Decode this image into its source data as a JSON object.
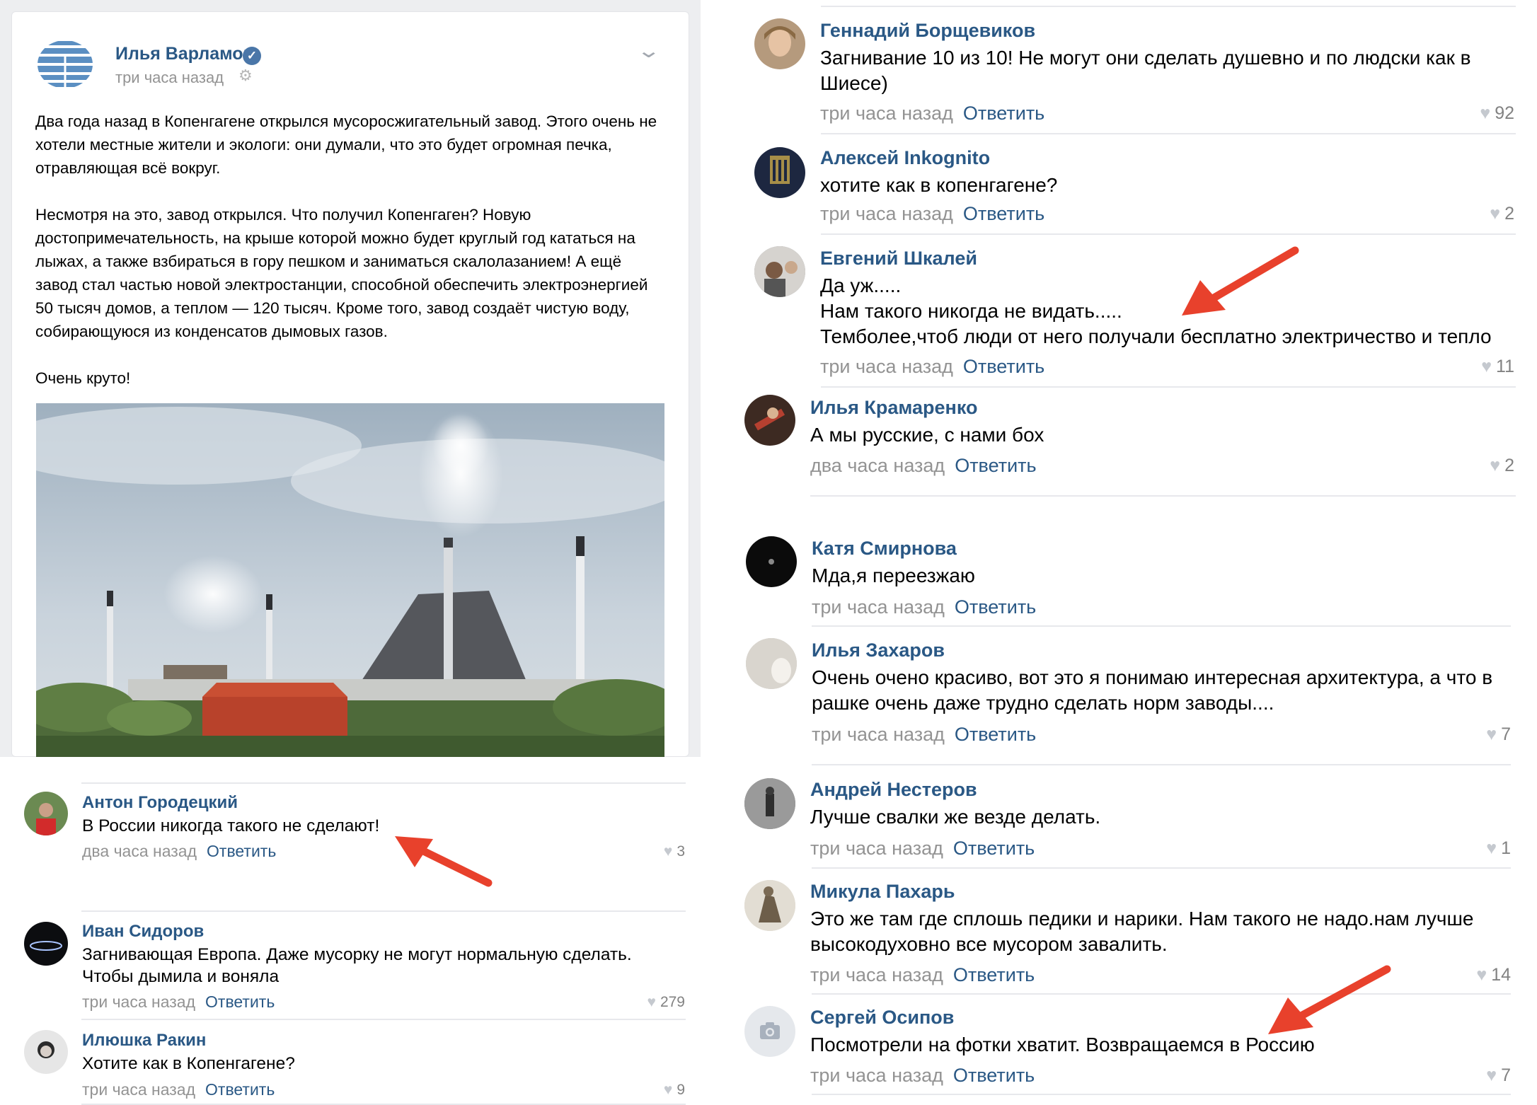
{
  "post": {
    "author": "Илья Варламов",
    "time": "три часа назад",
    "paragraphs": [
      "Два года назад в Копенгагене открылся мусоросжигательный завод. Этого очень не хотели местные жители и экологи: они думали, что это будет огромная печка, отравляющая всё вокруг.",
      "Несмотря на это, завод открылся. Что получил Копенгаген? Новую достопримечательность, на крыше которой можно будет круглый год кататься на лыжах, а также взбираться в гору пешком и заниматься скалолазанием! А ещё завод стал частью новой электростанции, способной обеспечить электроэнергией 50 тысяч домов, а теплом — 120 тысяч. Кроме того, завод создаёт чистую воду, собирающуюся из конденсатов дымовых газов.",
      "Очень круто!"
    ]
  },
  "reply_label": "Ответить",
  "left_comments": [
    {
      "name": "Антон Городецкий",
      "text": "В России никогда такого не сделают!",
      "time": "два часа назад",
      "likes": "3"
    },
    {
      "name": "Иван Сидоров",
      "text": "Загнивающая Европа. Даже мусорку не могут нормальную сделать. Чтобы дымила и воняла",
      "time": "три часа назад",
      "likes": "279"
    },
    {
      "name": "Илюшка Ракин",
      "text": "Хотите как в Копенгагене?",
      "time": "три часа назад",
      "likes": "9"
    }
  ],
  "right_comments": [
    {
      "name": "Геннадий Борщевиков",
      "text": "Загнивание 10 из 10! Не могут они сделать душевно и по людски как в Шиесе)",
      "time": "три часа назад",
      "likes": "92"
    },
    {
      "name": "Алексей Inkognito",
      "text": "хотите как в копенгагене?",
      "time": "три часа назад",
      "likes": "2"
    },
    {
      "name": "Евгений Шкалей",
      "text_lines": [
        "Да уж.....",
        "Нам такого никогда не видать.....",
        "Темболее,чтоб люди от него получали бесплатно электричество и тепло"
      ],
      "time": "три часа назад",
      "likes": "11"
    },
    {
      "name": "Илья Крамаренко",
      "text": "А мы русские, с нами бох",
      "time": "два часа назад",
      "likes": "2"
    },
    {
      "name": "Катя Смирнова",
      "text": "Мда,я переезжаю",
      "time": "три часа назад",
      "likes": ""
    },
    {
      "name": "Илья Захаров",
      "text": "Очень очено красиво, вот это я понимаю интересная архитектура, а что в рашке очень даже трудно сделать норм заводы....",
      "time": "три часа назад",
      "likes": "7"
    },
    {
      "name": "Андрей Нестеров",
      "text": "Лучше свалки же везде делать.",
      "time": "три часа назад",
      "likes": "1"
    },
    {
      "name": "Микула Пахарь",
      "text": "Это же там где сплошь педики и нарики. Нам такого не надо.нам лучше высокодуховно все мусором завалить.",
      "time": "три часа назад",
      "likes": "14"
    },
    {
      "name": "Сергей Осипов",
      "text": "Посмотрели на фотки хватит. Возвращаемся в Россию",
      "time": "три часа назад",
      "likes": "7"
    }
  ],
  "colors": {
    "link": "#2a5885",
    "muted": "#939393",
    "arrow": "#e8412c"
  }
}
